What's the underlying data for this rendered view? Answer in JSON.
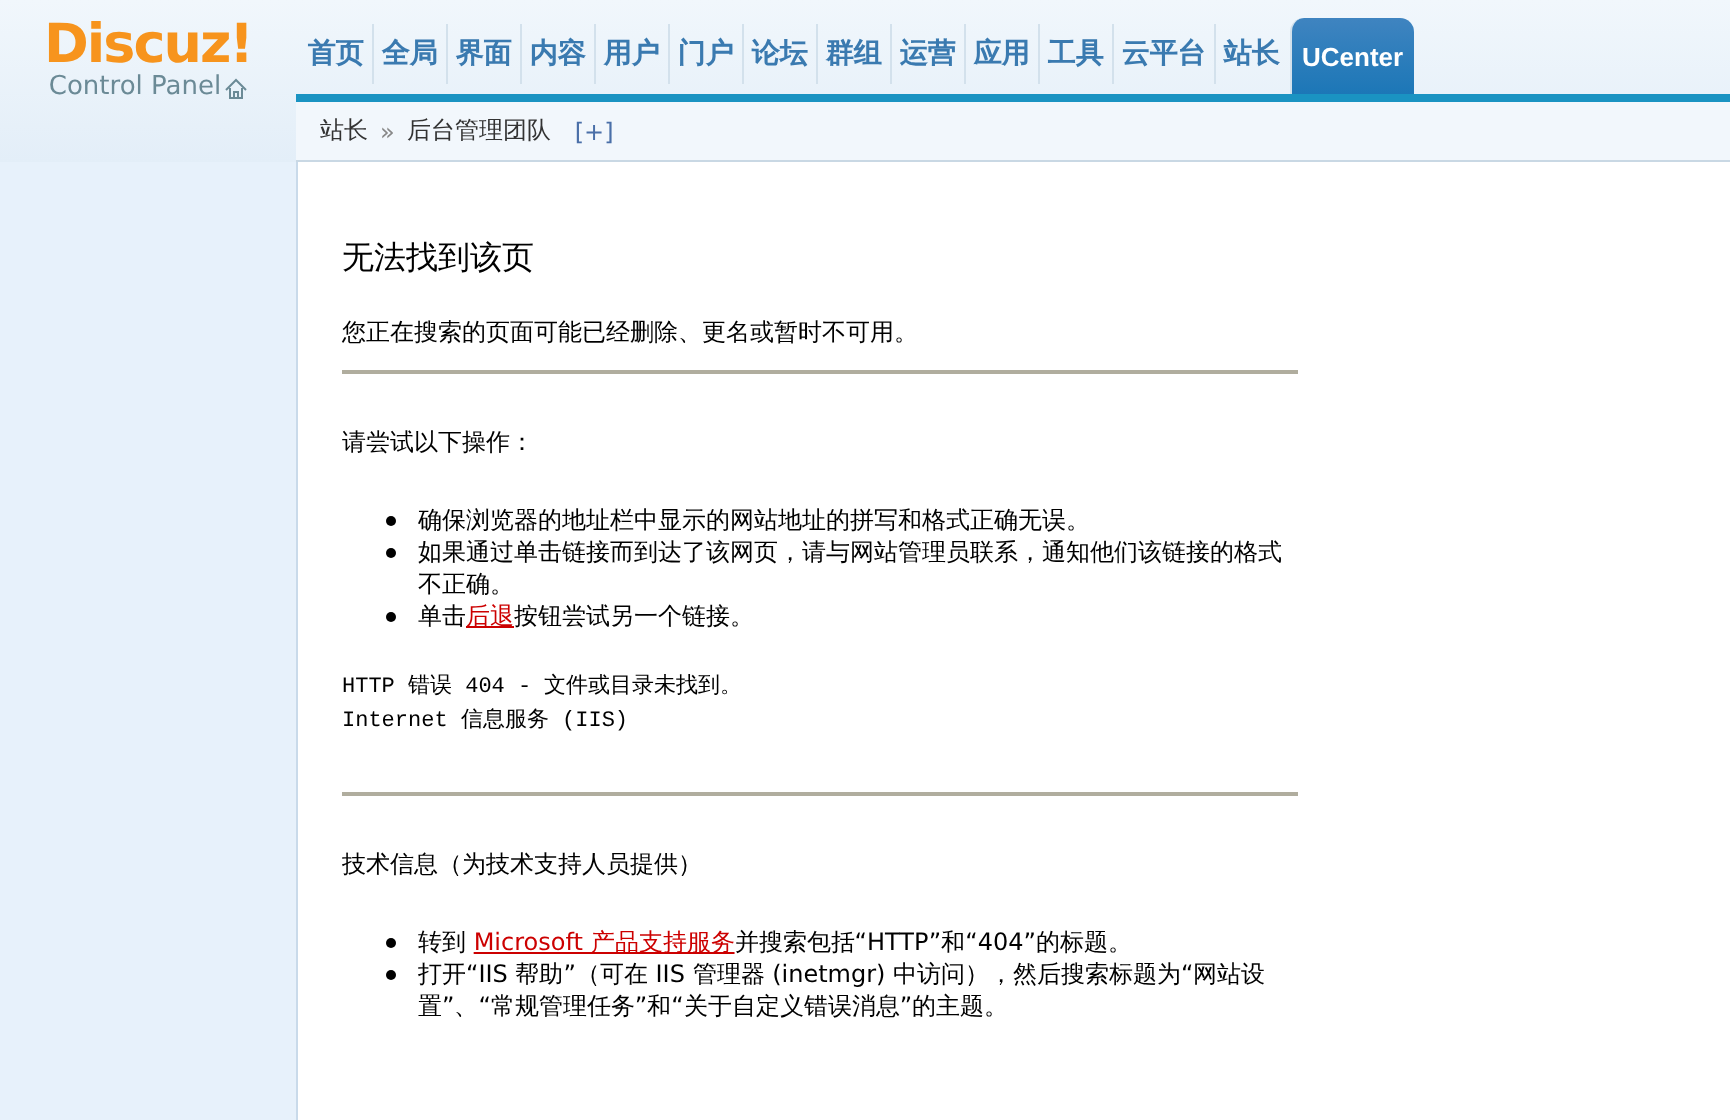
{
  "logo": {
    "brand": "Discuz!",
    "subtitle": "Control Panel"
  },
  "nav": [
    {
      "label": "首页",
      "selected": false
    },
    {
      "label": "全局",
      "selected": false
    },
    {
      "label": "界面",
      "selected": false
    },
    {
      "label": "内容",
      "selected": false
    },
    {
      "label": "用户",
      "selected": false
    },
    {
      "label": "门户",
      "selected": false
    },
    {
      "label": "论坛",
      "selected": false
    },
    {
      "label": "群组",
      "selected": false
    },
    {
      "label": "运营",
      "selected": false
    },
    {
      "label": "应用",
      "selected": false
    },
    {
      "label": "工具",
      "selected": false
    },
    {
      "label": "云平台",
      "selected": false
    },
    {
      "label": "站长",
      "selected": false
    },
    {
      "label": "UCenter",
      "selected": true
    }
  ],
  "breadcrumb": {
    "parent": "站长",
    "separator": "»",
    "current": "后台管理团队",
    "add": "[+]"
  },
  "error": {
    "title": "无法找到该页",
    "message": "您正在搜索的页面可能已经删除、更名或暂时不可用。",
    "try_heading": "请尝试以下操作：",
    "try_items": [
      {
        "before": "确保浏览器的地址栏中显示的网站地址的拼写和格式正确无误。"
      },
      {
        "before": "如果通过单击链接而到达了该网页，请与网站管理员联系，通知他们该链接的格式不正确。"
      },
      {
        "before": "单击",
        "link": "后退",
        "after": "按钮尝试另一个链接。"
      }
    ],
    "status_lines": [
      "HTTP 错误 404 - 文件或目录未找到。",
      "Internet 信息服务 (IIS)"
    ],
    "tech_heading": "技术信息（为技术支持人员提供）",
    "tech_items": [
      {
        "before": "转到 ",
        "link": "Microsoft 产品支持服务",
        "after": "并搜索包括“HTTP”和“404”的标题。"
      },
      {
        "before": "打开“IIS 帮助”（可在 IIS 管理器 (inetmgr) 中访问），然后搜索标题为“网站设置”、“常规管理任务”和“关于自定义错误消息”的主题。"
      }
    ]
  }
}
